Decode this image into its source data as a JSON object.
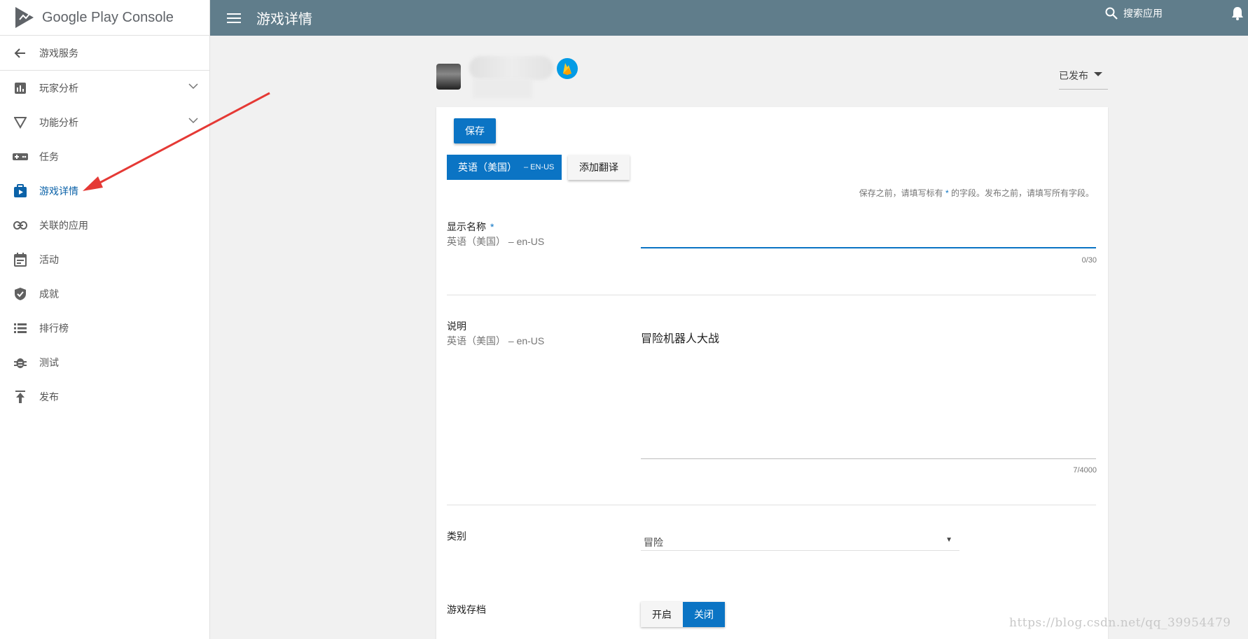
{
  "brand": {
    "name": "Google Play Console"
  },
  "sidebar": {
    "back_label": "游戏服务",
    "items": [
      {
        "label": "玩家分析",
        "icon": "bar-chart-icon",
        "expandable": true
      },
      {
        "label": "功能分析",
        "icon": "funnel-icon",
        "expandable": true
      },
      {
        "label": "任务",
        "icon": "gamepad-icon"
      },
      {
        "label": "游戏详情",
        "icon": "game-details-icon",
        "active": true
      },
      {
        "label": "关联的应用",
        "icon": "link-icon"
      },
      {
        "label": "活动",
        "icon": "calendar-icon"
      },
      {
        "label": "成就",
        "icon": "shield-check-icon"
      },
      {
        "label": "排行榜",
        "icon": "list-icon"
      },
      {
        "label": "测试",
        "icon": "bug-icon"
      },
      {
        "label": "发布",
        "icon": "publish-icon"
      }
    ]
  },
  "topbar": {
    "title": "游戏详情",
    "search_label": "搜索应用"
  },
  "header": {
    "status": "已发布"
  },
  "form": {
    "save_label": "保存",
    "lang_tab": {
      "label": "英语（美国）",
      "code": "– EN-US"
    },
    "add_translation_label": "添加翻译",
    "hint_before": "保存之前，请填写标有 ",
    "hint_star": "*",
    "hint_after": " 的字段。发布之前，请填写所有字段。",
    "display_name": {
      "label": "显示名称",
      "required": "*",
      "sub": "英语（美国） – en-US",
      "value": "",
      "counter": "0/30"
    },
    "description": {
      "label": "说明",
      "sub": "英语（美国） – en-US",
      "value": "冒险机器人大战",
      "counter": "7/4000"
    },
    "category": {
      "label": "类别",
      "value": "冒险"
    },
    "saved_games": {
      "label": "游戏存档",
      "on_label": "开启",
      "off_label": "关闭",
      "selected": "关闭"
    }
  },
  "watermark": "https://blog.csdn.net/qq_39954479",
  "colors": {
    "accent": "#0b74c4",
    "topbar": "#607d8b",
    "annotation": "#e53935"
  }
}
